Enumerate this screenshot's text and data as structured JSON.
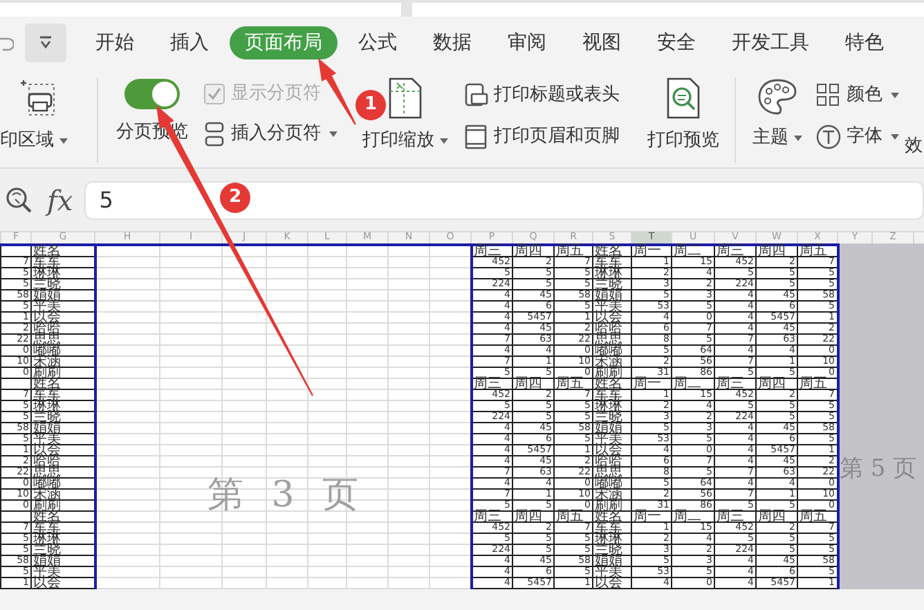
{
  "tabs": [
    {
      "label": "开始",
      "selected": false
    },
    {
      "label": "插入",
      "selected": false
    },
    {
      "label": "页面布局",
      "selected": true
    },
    {
      "label": "公式",
      "selected": false
    },
    {
      "label": "数据",
      "selected": false
    },
    {
      "label": "审阅",
      "selected": false
    },
    {
      "label": "视图",
      "selected": false
    },
    {
      "label": "安全",
      "selected": false
    },
    {
      "label": "开发工具",
      "selected": false
    },
    {
      "label": "特色",
      "selected": false
    }
  ],
  "ribbon": {
    "print_area": {
      "label": "印区域",
      "dropdown": true
    },
    "page_preview": {
      "label": "分页预览",
      "on": true
    },
    "show_breaks": {
      "label": "显示分页符",
      "checked": true,
      "disabled": true
    },
    "insert_break": {
      "label": "插入分页符",
      "dropdown": true
    },
    "print_scale": {
      "label": "打印缩放",
      "dropdown": true
    },
    "print_titles": {
      "label": "打印标题或表头"
    },
    "header_footer": {
      "label": "打印页眉和页脚"
    },
    "print_preview": {
      "label": "打印预览"
    },
    "theme": {
      "label": "主题",
      "dropdown": true
    },
    "colors": {
      "label": "颜色",
      "dropdown": true
    },
    "fonts": {
      "label": "字体",
      "dropdown": true
    },
    "effects": {
      "label": "效"
    }
  },
  "formula_bar": {
    "fx": "fx",
    "value": "5"
  },
  "sheet": {
    "columns": [
      {
        "label": "F",
        "selected": false
      },
      {
        "label": "G",
        "selected": false
      },
      {
        "label": "H",
        "selected": false
      },
      {
        "label": "I",
        "selected": false
      },
      {
        "label": "J",
        "selected": false
      },
      {
        "label": "K",
        "selected": false
      },
      {
        "label": "L",
        "selected": false
      },
      {
        "label": "M",
        "selected": false
      },
      {
        "label": "N",
        "selected": false
      },
      {
        "label": "O",
        "selected": false
      },
      {
        "label": "P",
        "selected": false
      },
      {
        "label": "Q",
        "selected": false
      },
      {
        "label": "R",
        "selected": false
      },
      {
        "label": "S",
        "selected": false
      },
      {
        "label": "T",
        "selected": true
      },
      {
        "label": "U",
        "selected": false
      },
      {
        "label": "V",
        "selected": false
      },
      {
        "label": "W",
        "selected": false
      },
      {
        "label": "X",
        "selected": false
      },
      {
        "label": "Y",
        "selected": false
      },
      {
        "label": "Z",
        "selected": false
      }
    ],
    "rows": [
      {
        "kind": "header",
        "cells": [
          "",
          "姓名",
          "",
          "",
          "",
          "",
          "",
          "",
          "",
          "",
          "周三",
          "周四",
          "周五",
          "姓名",
          "周一",
          "周二",
          "周三",
          "周四",
          "周五"
        ]
      },
      {
        "kind": "data",
        "cells": [
          "7",
          "军军",
          "",
          "",
          "",
          "",
          "",
          "",
          "",
          "",
          "452",
          "2",
          "7",
          "军军",
          "1",
          "15",
          "452",
          "2",
          "7"
        ]
      },
      {
        "kind": "data",
        "cells": [
          "5",
          "琳琳",
          "",
          "",
          "",
          "",
          "",
          "",
          "",
          "",
          "5",
          "5",
          "5",
          "琳琳",
          "2",
          "4",
          "5",
          "5",
          "5"
        ]
      },
      {
        "kind": "data",
        "cells": [
          "5",
          "兰晓",
          "",
          "",
          "",
          "",
          "",
          "",
          "",
          "",
          "224",
          "5",
          "5",
          "兰晓",
          "3",
          "2",
          "224",
          "5",
          "5"
        ]
      },
      {
        "kind": "data",
        "cells": [
          "58",
          "娟娟",
          "",
          "",
          "",
          "",
          "",
          "",
          "",
          "",
          "4",
          "45",
          "58",
          "娟娟",
          "5",
          "3",
          "4",
          "45",
          "58"
        ]
      },
      {
        "kind": "data",
        "cells": [
          "5",
          "平美",
          "",
          "",
          "",
          "",
          "",
          "",
          "",
          "",
          "4",
          "6",
          "5",
          "平美",
          "53",
          "5",
          "4",
          "6",
          "5"
        ]
      },
      {
        "kind": "data",
        "cells": [
          "1",
          "以会",
          "",
          "",
          "",
          "",
          "",
          "",
          "",
          "",
          "4",
          "5457",
          "1",
          "以会",
          "4",
          "0",
          "4",
          "5457",
          "1"
        ]
      },
      {
        "kind": "data",
        "cells": [
          "2",
          "哈哈",
          "",
          "",
          "",
          "",
          "",
          "",
          "",
          "",
          "4",
          "45",
          "2",
          "哈哈",
          "6",
          "7",
          "4",
          "45",
          "2"
        ]
      },
      {
        "kind": "data",
        "cells": [
          "22",
          "思思",
          "",
          "",
          "",
          "",
          "",
          "",
          "",
          "",
          "7",
          "63",
          "22",
          "思思",
          "8",
          "5",
          "7",
          "63",
          "22"
        ]
      },
      {
        "kind": "data",
        "cells": [
          "0",
          "嘟嘟",
          "",
          "",
          "",
          "",
          "",
          "",
          "",
          "",
          "4",
          "4",
          "0",
          "嘟嘟",
          "5",
          "64",
          "4",
          "4",
          "0"
        ]
      },
      {
        "kind": "data",
        "cells": [
          "10",
          "宋涵",
          "",
          "",
          "",
          "",
          "",
          "",
          "",
          "",
          "7",
          "1",
          "10",
          "宋涵",
          "2",
          "56",
          "7",
          "1",
          "10"
        ]
      },
      {
        "kind": "data",
        "cells": [
          "0",
          "刷刷",
          "",
          "",
          "",
          "",
          "",
          "",
          "",
          "",
          "5",
          "5",
          "0",
          "刷刷",
          "31",
          "86",
          "5",
          "5",
          "0"
        ]
      },
      {
        "kind": "header",
        "cells": [
          "",
          "姓名",
          "",
          "",
          "",
          "",
          "",
          "",
          "",
          "",
          "周三",
          "周四",
          "周五",
          "姓名",
          "周一",
          "周二",
          "周三",
          "周四",
          "周五"
        ]
      },
      {
        "kind": "data",
        "cells": [
          "7",
          "军军",
          "",
          "",
          "",
          "",
          "",
          "",
          "",
          "",
          "452",
          "2",
          "7",
          "军军",
          "1",
          "15",
          "452",
          "2",
          "7"
        ]
      },
      {
        "kind": "data",
        "cells": [
          "5",
          "琳琳",
          "",
          "",
          "",
          "",
          "",
          "",
          "",
          "",
          "5",
          "5",
          "5",
          "琳琳",
          "2",
          "4",
          "5",
          "5",
          "5"
        ]
      },
      {
        "kind": "data",
        "cells": [
          "5",
          "兰晓",
          "",
          "",
          "",
          "",
          "",
          "",
          "",
          "",
          "224",
          "5",
          "5",
          "兰晓",
          "3",
          "2",
          "224",
          "5",
          "5"
        ]
      },
      {
        "kind": "data",
        "cells": [
          "58",
          "娟娟",
          "",
          "",
          "",
          "",
          "",
          "",
          "",
          "",
          "4",
          "45",
          "58",
          "娟娟",
          "5",
          "3",
          "4",
          "45",
          "58"
        ]
      },
      {
        "kind": "data",
        "cells": [
          "5",
          "平美",
          "",
          "",
          "",
          "",
          "",
          "",
          "",
          "",
          "4",
          "6",
          "5",
          "平美",
          "53",
          "5",
          "4",
          "6",
          "5"
        ]
      },
      {
        "kind": "data",
        "cells": [
          "1",
          "以会",
          "",
          "",
          "",
          "",
          "",
          "",
          "",
          "",
          "4",
          "5457",
          "1",
          "以会",
          "4",
          "0",
          "4",
          "5457",
          "1"
        ]
      },
      {
        "kind": "data",
        "cells": [
          "2",
          "哈哈",
          "",
          "",
          "",
          "",
          "",
          "",
          "",
          "",
          "4",
          "45",
          "2",
          "哈哈",
          "6",
          "7",
          "4",
          "45",
          "2"
        ]
      },
      {
        "kind": "data",
        "cells": [
          "22",
          "思思",
          "",
          "",
          "",
          "",
          "",
          "",
          "",
          "",
          "7",
          "63",
          "22",
          "思思",
          "8",
          "5",
          "7",
          "63",
          "22"
        ]
      },
      {
        "kind": "data",
        "cells": [
          "0",
          "嘟嘟",
          "",
          "",
          "",
          "",
          "",
          "",
          "",
          "",
          "4",
          "4",
          "0",
          "嘟嘟",
          "5",
          "64",
          "4",
          "4",
          "0"
        ]
      },
      {
        "kind": "data",
        "cells": [
          "10",
          "宋涵",
          "",
          "",
          "",
          "",
          "",
          "",
          "",
          "",
          "7",
          "1",
          "10",
          "宋涵",
          "2",
          "56",
          "7",
          "1",
          "10"
        ]
      },
      {
        "kind": "data",
        "cells": [
          "0",
          "刷刷",
          "",
          "",
          "",
          "",
          "",
          "",
          "",
          "",
          "5",
          "5",
          "0",
          "刷刷",
          "31",
          "86",
          "5",
          "5",
          "0"
        ]
      },
      {
        "kind": "header",
        "cells": [
          "",
          "姓名",
          "",
          "",
          "",
          "",
          "",
          "",
          "",
          "",
          "周三",
          "周四",
          "周五",
          "姓名",
          "周一",
          "周二",
          "周三",
          "周四",
          "周五"
        ]
      },
      {
        "kind": "data",
        "cells": [
          "7",
          "军军",
          "",
          "",
          "",
          "",
          "",
          "",
          "",
          "",
          "452",
          "2",
          "7",
          "军军",
          "1",
          "15",
          "452",
          "2",
          "7"
        ]
      },
      {
        "kind": "data",
        "cells": [
          "5",
          "琳琳",
          "",
          "",
          "",
          "",
          "",
          "",
          "",
          "",
          "5",
          "5",
          "5",
          "琳琳",
          "2",
          "4",
          "5",
          "5",
          "5"
        ]
      },
      {
        "kind": "data",
        "cells": [
          "5",
          "兰晓",
          "",
          "",
          "",
          "",
          "",
          "",
          "",
          "",
          "224",
          "5",
          "5",
          "兰晓",
          "3",
          "2",
          "224",
          "5",
          "5"
        ]
      },
      {
        "kind": "data",
        "cells": [
          "58",
          "娟娟",
          "",
          "",
          "",
          "",
          "",
          "",
          "",
          "",
          "4",
          "45",
          "58",
          "娟娟",
          "5",
          "3",
          "4",
          "45",
          "58"
        ]
      },
      {
        "kind": "data",
        "cells": [
          "5",
          "平美",
          "",
          "",
          "",
          "",
          "",
          "",
          "",
          "",
          "4",
          "6",
          "5",
          "平美",
          "53",
          "5",
          "4",
          "6",
          "5"
        ]
      },
      {
        "kind": "data",
        "cells": [
          "1",
          "以会",
          "",
          "",
          "",
          "",
          "",
          "",
          "",
          "",
          "4",
          "5457",
          "1",
          "以会",
          "4",
          "0",
          "4",
          "5457",
          "1"
        ]
      }
    ],
    "page_labels": [
      "第 3 页",
      "第 5 页"
    ]
  },
  "annotations": [
    {
      "label": "1"
    },
    {
      "label": "2"
    }
  ]
}
